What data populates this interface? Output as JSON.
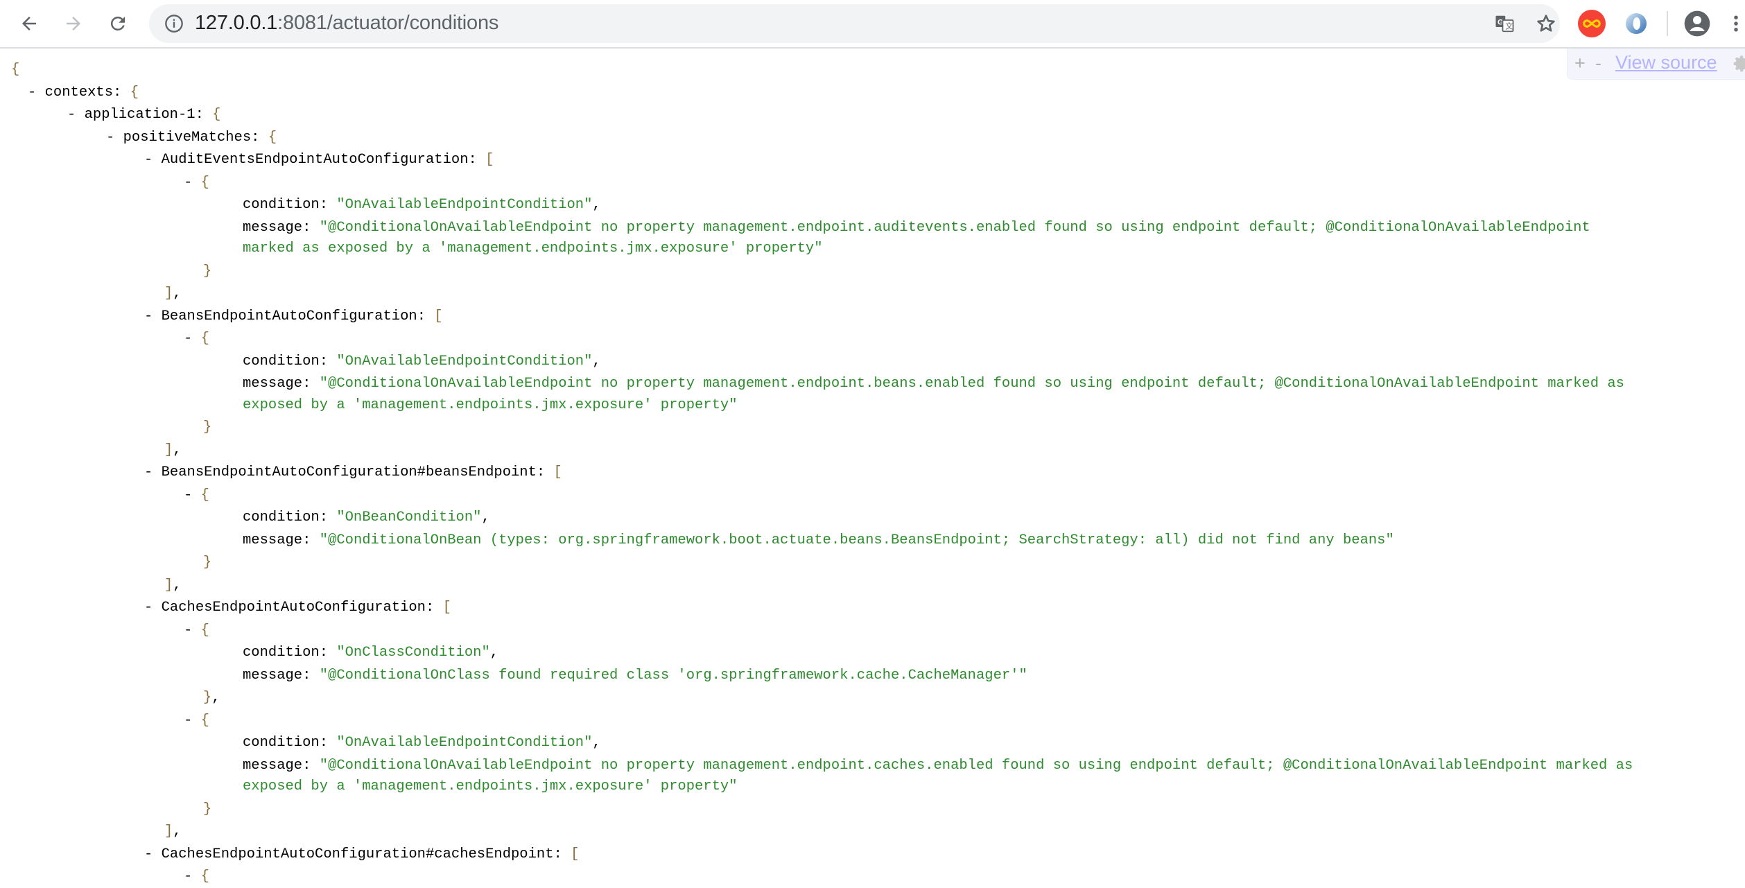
{
  "browser": {
    "url_host": "127.0.0.1",
    "url_rest": ":8081/actuator/conditions",
    "back_icon": "arrow-left-icon",
    "forward_icon": "arrow-right-icon",
    "reload_icon": "reload-icon",
    "site_info_icon": "info-icon",
    "translate_icon": "translate-icon",
    "bookmark_icon": "star-icon",
    "extensions": [
      "infinity-extension-icon",
      "blue-ring-extension-icon"
    ],
    "profile_icon": "account-circle-icon",
    "menu_icon": "more-vertical-icon"
  },
  "viewer_controls": {
    "expand_label": "+",
    "collapse_label": "-",
    "view_source_label": "View source",
    "settings_icon": "gear-icon"
  },
  "colors": {
    "string": "#2e8b2e",
    "brace": "#8a6d3b",
    "key": "#000000",
    "link": "#b3b3ff"
  },
  "json": {
    "root_open": "{",
    "contexts_key": "contexts",
    "app_key": "application-1",
    "positive_key": "positiveMatches",
    "entries": [
      {
        "name": "AuditEventsEndpointAutoConfiguration",
        "items": [
          {
            "condition": "\"OnAvailableEndpointCondition\"",
            "message_line1": "\"@ConditionalOnAvailableEndpoint no property management.endpoint.auditevents.enabled found so using endpoint default; @ConditionalOnAvailableEndpoint",
            "message_line2": "marked as exposed by a 'management.endpoints.jmx.exposure' property\""
          }
        ]
      },
      {
        "name": "BeansEndpointAutoConfiguration",
        "items": [
          {
            "condition": "\"OnAvailableEndpointCondition\"",
            "message_line1": "\"@ConditionalOnAvailableEndpoint no property management.endpoint.beans.enabled found so using endpoint default; @ConditionalOnAvailableEndpoint marked as",
            "message_line2": "exposed by a 'management.endpoints.jmx.exposure' property\""
          }
        ]
      },
      {
        "name": "BeansEndpointAutoConfiguration#beansEndpoint",
        "items": [
          {
            "condition": "\"OnBeanCondition\"",
            "message_line1": "\"@ConditionalOnBean (types: org.springframework.boot.actuate.beans.BeansEndpoint; SearchStrategy: all) did not find any beans\""
          }
        ]
      },
      {
        "name": "CachesEndpointAutoConfiguration",
        "items": [
          {
            "condition": "\"OnClassCondition\"",
            "message_line1": "\"@ConditionalOnClass found required class 'org.springframework.cache.CacheManager'\""
          },
          {
            "condition": "\"OnAvailableEndpointCondition\"",
            "message_line1": "\"@ConditionalOnAvailableEndpoint no property management.endpoint.caches.enabled found so using endpoint default; @ConditionalOnAvailableEndpoint marked as",
            "message_line2": "exposed by a 'management.endpoints.jmx.exposure' property\""
          }
        ]
      },
      {
        "name": "CachesEndpointAutoConfiguration#cachesEndpoint",
        "items": []
      }
    ],
    "labels": {
      "condition": "condition",
      "message": "message",
      "dash": "-"
    }
  }
}
